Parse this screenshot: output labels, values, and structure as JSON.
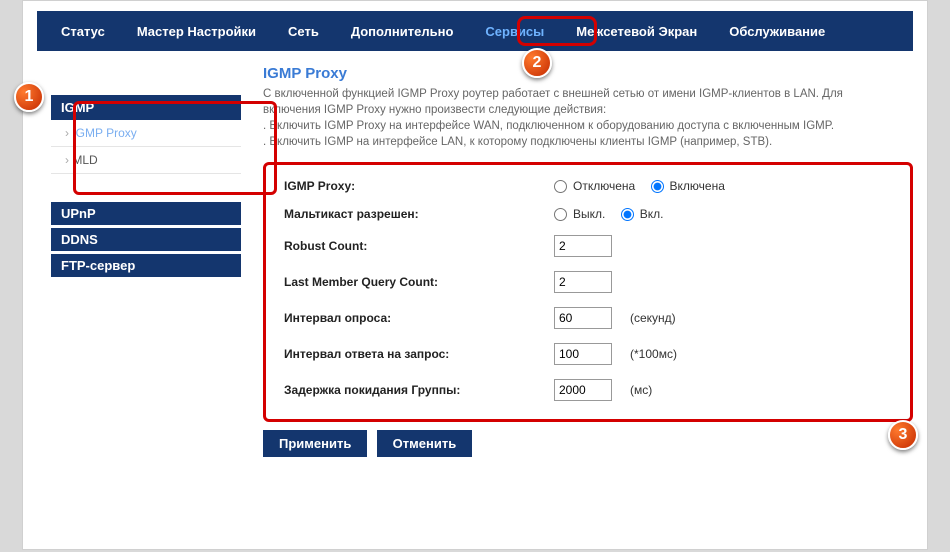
{
  "nav": {
    "items": [
      "Статус",
      "Мастер Настройки",
      "Сеть",
      "Дополнительно",
      "Сервисы",
      "Межсетевой Экран",
      "Обслуживание"
    ],
    "active_index": 4
  },
  "sidebar": {
    "header": "IGMP",
    "subs": [
      {
        "label": "IGMP Proxy",
        "active": true
      },
      {
        "label": "MLD",
        "active": false
      }
    ],
    "links": [
      "UPnP",
      "DDNS",
      "FTP-сервер"
    ]
  },
  "page": {
    "title": "IGMP Proxy",
    "desc_line1": "С включенной функцией IGMP Proxy роутер работает с внешней сетью от имени IGMP-клиентов в LAN. Для включения IGMP Proxy нужно произвести следующие действия:",
    "desc_line2": ". Включить IGMP Proxy на интерфейсе WAN, подключенном к оборудованию доступа с включенным IGMP.",
    "desc_line3": ". Включить IGMP на интерфейсе LAN, к которому подключены клиенты IGMP (например, STB)."
  },
  "form": {
    "igmp_proxy_label": "IGMP Proxy:",
    "igmp_proxy_off": "Отключена",
    "igmp_proxy_on": "Включена",
    "multicast_label": "Мальтикаст разрешен:",
    "multicast_off": "Выкл.",
    "multicast_on": "Вкл.",
    "robust_label": "Robust Count:",
    "robust_value": "2",
    "lmqc_label": "Last Member Query Count:",
    "lmqc_value": "2",
    "poll_label": "Интервал опроса:",
    "poll_value": "60",
    "poll_unit": "(секунд)",
    "resp_label": "Интервал ответа на запрос:",
    "resp_value": "100",
    "resp_unit": "(*100мс)",
    "leave_label": "Задержка покидания Группы:",
    "leave_value": "2000",
    "leave_unit": "(мс)"
  },
  "buttons": {
    "apply": "Применить",
    "cancel": "Отменить"
  },
  "callouts": {
    "c1": "1",
    "c2": "2",
    "c3": "3"
  }
}
